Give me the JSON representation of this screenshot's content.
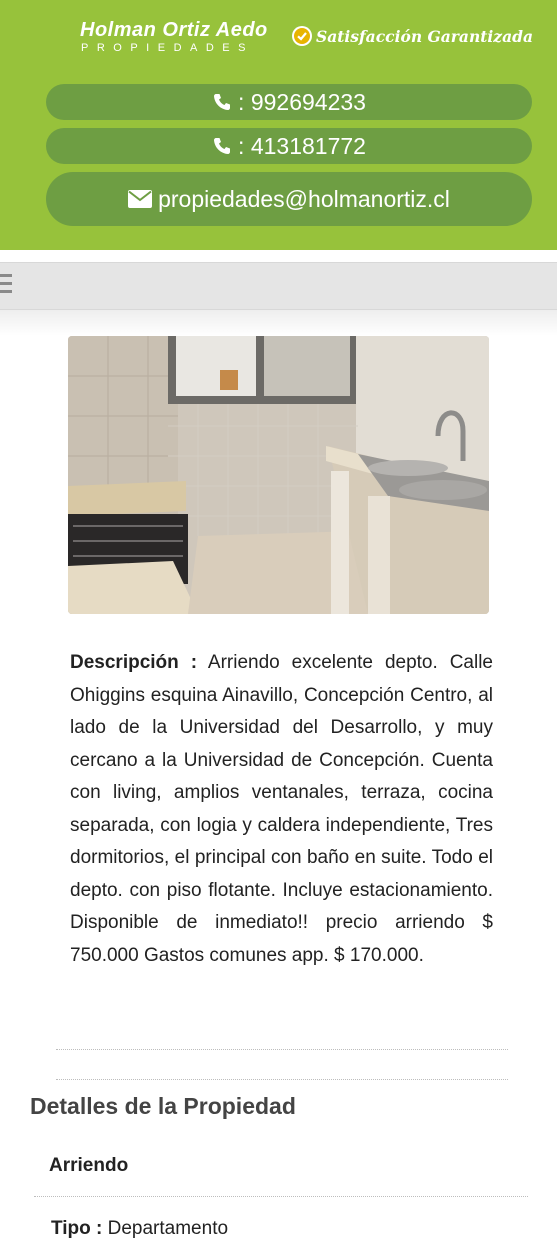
{
  "header": {
    "logo_name": "Holman Ortiz Aedo",
    "logo_sub": "PROPIEDADES",
    "tagline": "Satisfacción Garantizada",
    "brand_color": "#97c23b",
    "pill_color": "#6e9e43"
  },
  "contacts": {
    "phone1": ": 992694233",
    "phone2": ": 413181772",
    "email": "propiedades@holmanortiz.cl"
  },
  "property": {
    "description_label": "Descripción :",
    "description_text": " Arriendo excelente depto. Calle Ohiggins esquina Ainavillo, Concepción Centro, al lado de la Universidad del Desarrollo, y muy cercano a la Universidad de Concepción. Cuenta con living, amplios ventanales, terraza, cocina separada, con logia y caldera independiente, Tres dormitorios, el principal con baño en suite. Todo el depto. con piso flotante. Incluye estacionamiento. Disponible de inmediato!! precio arriendo $ 750.000 Gastos comunes app. $ 170.000."
  },
  "details": {
    "title": "Detalles de la Propiedad",
    "operation": "Arriendo",
    "type_label": "Tipo :",
    "type_value": " Departamento"
  },
  "icons": {
    "menu": "menu-icon",
    "phone": "phone-icon",
    "email": "envelope-icon",
    "check": "check-circle-icon"
  }
}
